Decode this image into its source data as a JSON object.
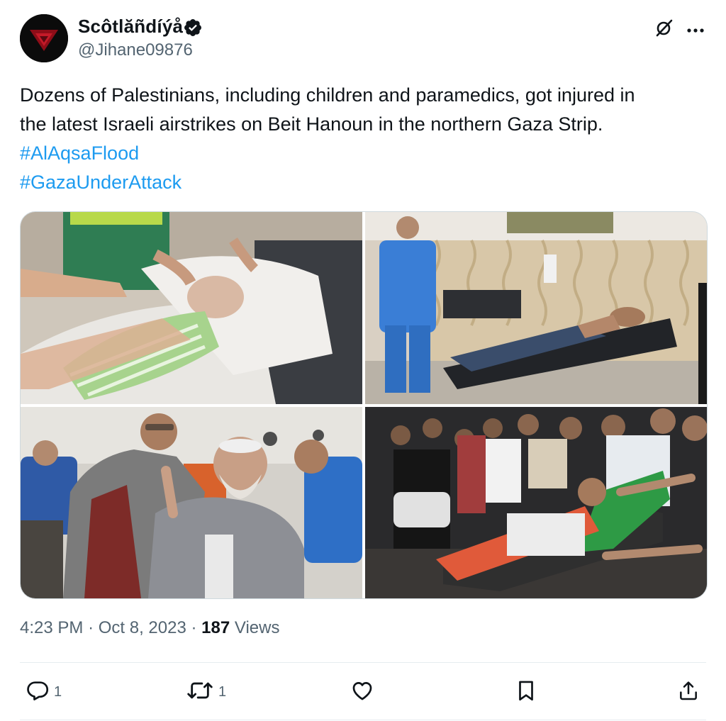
{
  "author": {
    "display_name": "Scôtlăñdíýå",
    "handle": "@Jihane09876",
    "avatar_icon": "red-triangle-avatar",
    "verified_icon": "verified-badge-icon"
  },
  "header_actions": {
    "grok_icon": "grok-icon",
    "more_icon": "more-horizontal-icon"
  },
  "tweet": {
    "text_line1": "Dozens of Palestinians, including children and paramedics, got injured in",
    "text_line2": "the latest Israeli airstrikes on Beit Hanoun in the northern Gaza Strip.",
    "hashtag1": "#AlAqsaFlood",
    "hashtag2": "#GazaUnderAttack",
    "hashtag_color": "#1d9bf0"
  },
  "media": [
    {
      "subject": "infant-treatment-photo"
    },
    {
      "subject": "injured-man-on-stretcher-photo"
    },
    {
      "subject": "elderly-man-in-hospital-photo"
    },
    {
      "subject": "paramedic-carried-on-stretcher-photo"
    }
  ],
  "meta": {
    "time": "4:23 PM",
    "separator1": "·",
    "date": "Oct 8, 2023",
    "separator2": "·",
    "views_count": "187",
    "views_label": "Views"
  },
  "actions": {
    "reply_count": "1",
    "repost_count": "1",
    "reply_icon": "reply-icon",
    "repost_icon": "repost-icon",
    "like_icon": "heart-icon",
    "bookmark_icon": "bookmark-icon",
    "share_icon": "share-icon"
  }
}
